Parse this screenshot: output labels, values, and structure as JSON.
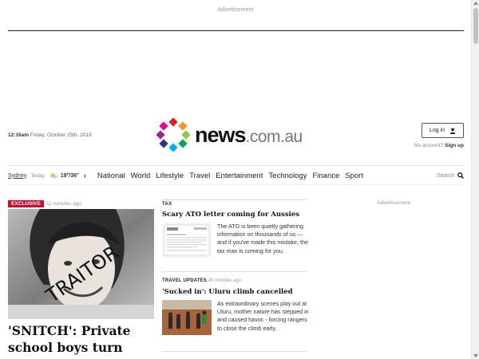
{
  "ads": {
    "top_label": "Advertisement",
    "right_label": "Advertisement"
  },
  "header": {
    "time": "12:16am",
    "date": "Friday, October 25th, 2019",
    "logo_news": "news",
    "logo_domain": ".com.au",
    "login_label": "Log in",
    "no_account": "No account?",
    "signup": "Sign up"
  },
  "nav": {
    "city": "Sydney",
    "today": "Today",
    "temps": "19°/36°",
    "items": [
      "National",
      "World",
      "Lifestyle",
      "Travel",
      "Entertainment",
      "Technology",
      "Finance",
      "Sport"
    ],
    "search_label": "Search"
  },
  "hero": {
    "badge": "EXCLUSIVE",
    "time": "11 minutes ago",
    "photo_text": "TRAITOR",
    "headline": "'SNITCH': Private school boys turn nasty after"
  },
  "stories": [
    {
      "tag": "TAX",
      "time": "",
      "title": "Scary ATO letter coming for Aussies",
      "blurb": "The ATO is been quietly gathering information on thousands of us — and if you've made this mistake, the tax man is coming for you."
    },
    {
      "tag": "TRAVEL UPDATES",
      "time": "40 minutes ago",
      "title": "'Sucked in': Uluru climb cancelled",
      "blurb": "As extraordinary scenes play out at Uluru, mother nature has stepped in and caused havoc - forcing rangers to close the climb early."
    }
  ],
  "colors": {
    "accent_red": "#c8102e",
    "logo_dots": [
      "#e31b23",
      "#f7941d",
      "#8dc63f",
      "#00a651",
      "#00aeef",
      "#2e3192",
      "#92278f",
      "#ec008c"
    ]
  }
}
